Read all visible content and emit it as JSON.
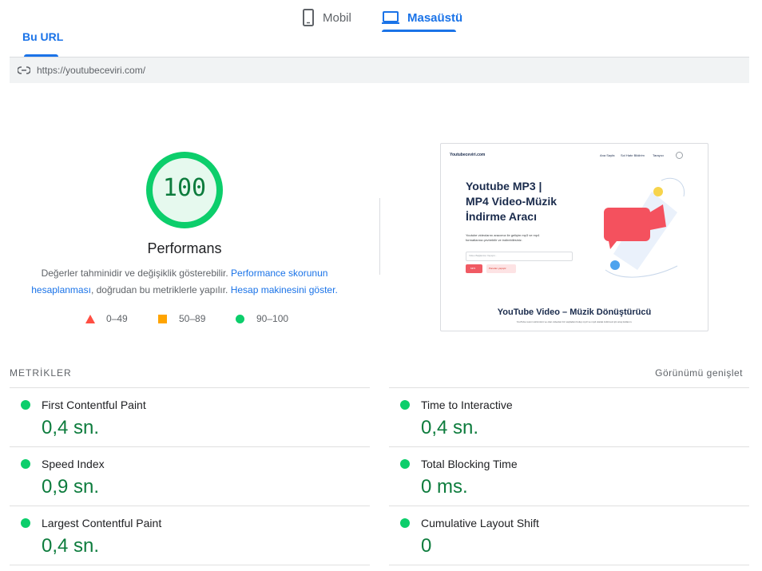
{
  "device_tabs": [
    {
      "label": "Mobil",
      "icon": "phone-icon",
      "selected": false
    },
    {
      "label": "Masaüstü",
      "icon": "laptop-icon",
      "selected": true
    }
  ],
  "url_tab": {
    "label": "Bu URL"
  },
  "url": "https://youtubeceviri.com/",
  "score": {
    "value": "100",
    "label": "Performans",
    "color": "#0cce6b",
    "text_color": "#0d7c3d"
  },
  "note": {
    "part1": "Değerler tahminidir ve değişiklik gösterebilir.",
    "link1": "Performance skorunun hesaplanması",
    "part2": ", doğrudan bu metriklerle yapılır.",
    "link2": "Hesap makinesini göster."
  },
  "legend": [
    {
      "shape": "triangle",
      "color": "#ff4e42",
      "range": "0–49"
    },
    {
      "shape": "square",
      "color": "#ffa400",
      "range": "50–89"
    },
    {
      "shape": "circle",
      "color": "#0cce6b",
      "range": "90–100"
    }
  ],
  "thumbnail": {
    "site_logo": "Youtubeceviri.com",
    "nav": [
      "Ana Sayfa",
      "Sol Hatır Bildirim",
      "Tarayıcı"
    ],
    "headline_lines": [
      "Youtube MP3 |",
      "MP4 Video-Müzik",
      "İndirme Aracı"
    ],
    "subtext": [
      "Youtube videolarını aracımız ile gelişim mp3 ve mp4",
      "formatlarına çevirebilir ve indirebilirsiniz."
    ],
    "input_placeholder": "Video Bağlantısı Yapıştır...",
    "btn_primary": "MP3",
    "btn_secondary": "Panolan yapıştır",
    "section_title": "YouTube Video – Müzik Dönüştürücü",
    "section_text": "YouTube resmi sürümünü ve olan videoları bir sayfadan bulup mp3 ve mp4 olarak indirmek için araç kullanın."
  },
  "metrics_section": {
    "title": "METRİKLER",
    "expand_label": "Görünümü genişlet"
  },
  "metrics": [
    {
      "name": "First Contentful Paint",
      "value": "0,4 sn.",
      "status_color": "#0cce6b"
    },
    {
      "name": "Time to Interactive",
      "value": "0,4 sn.",
      "status_color": "#0cce6b"
    },
    {
      "name": "Speed Index",
      "value": "0,9 sn.",
      "status_color": "#0cce6b"
    },
    {
      "name": "Total Blocking Time",
      "value": "0 ms.",
      "status_color": "#0cce6b"
    },
    {
      "name": "Largest Contentful Paint",
      "value": "0,4 sn.",
      "status_color": "#0cce6b"
    },
    {
      "name": "Cumulative Layout Shift",
      "value": "0",
      "status_color": "#0cce6b"
    }
  ]
}
